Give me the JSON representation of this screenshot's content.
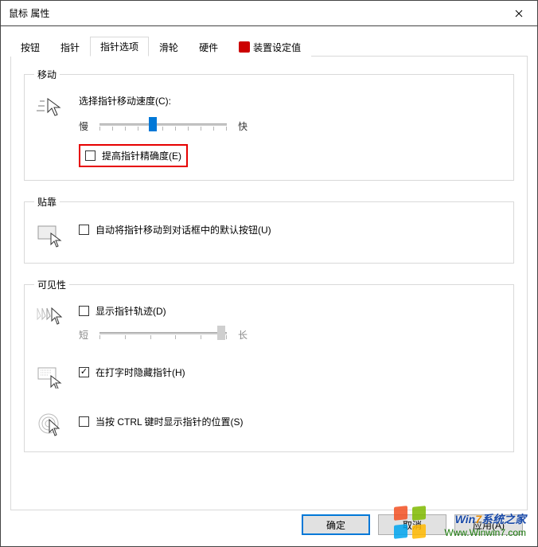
{
  "window": {
    "title": "鼠标 属性"
  },
  "tabs": {
    "items": [
      {
        "label": "按钮"
      },
      {
        "label": "指针"
      },
      {
        "label": "指针选项"
      },
      {
        "label": "滑轮"
      },
      {
        "label": "硬件"
      },
      {
        "label": "装置设定值"
      }
    ],
    "active_index": 2
  },
  "motion": {
    "legend": "移动",
    "speed_label": "选择指针移动速度(C):",
    "slow": "慢",
    "fast": "快",
    "enhance_precision": "提高指针精确度(E)",
    "enhance_checked": false
  },
  "snap": {
    "legend": "贴靠",
    "snap_default": "自动将指针移动到对话框中的默认按钮(U)",
    "snap_checked": false
  },
  "visibility": {
    "legend": "可见性",
    "trails": "显示指针轨迹(D)",
    "trails_checked": false,
    "short": "短",
    "long": "长",
    "hide_typing": "在打字时隐藏指针(H)",
    "hide_typing_checked": true,
    "ctrl_locate": "当按 CTRL 键时显示指针的位置(S)",
    "ctrl_locate_checked": false
  },
  "buttons": {
    "ok": "确定",
    "cancel": "取消",
    "apply": "应用(A)"
  },
  "watermark": {
    "line1_a": "Win",
    "line1_b": "7",
    "line1_c": "系统之家",
    "line2": "Www.Winwin7.com"
  }
}
